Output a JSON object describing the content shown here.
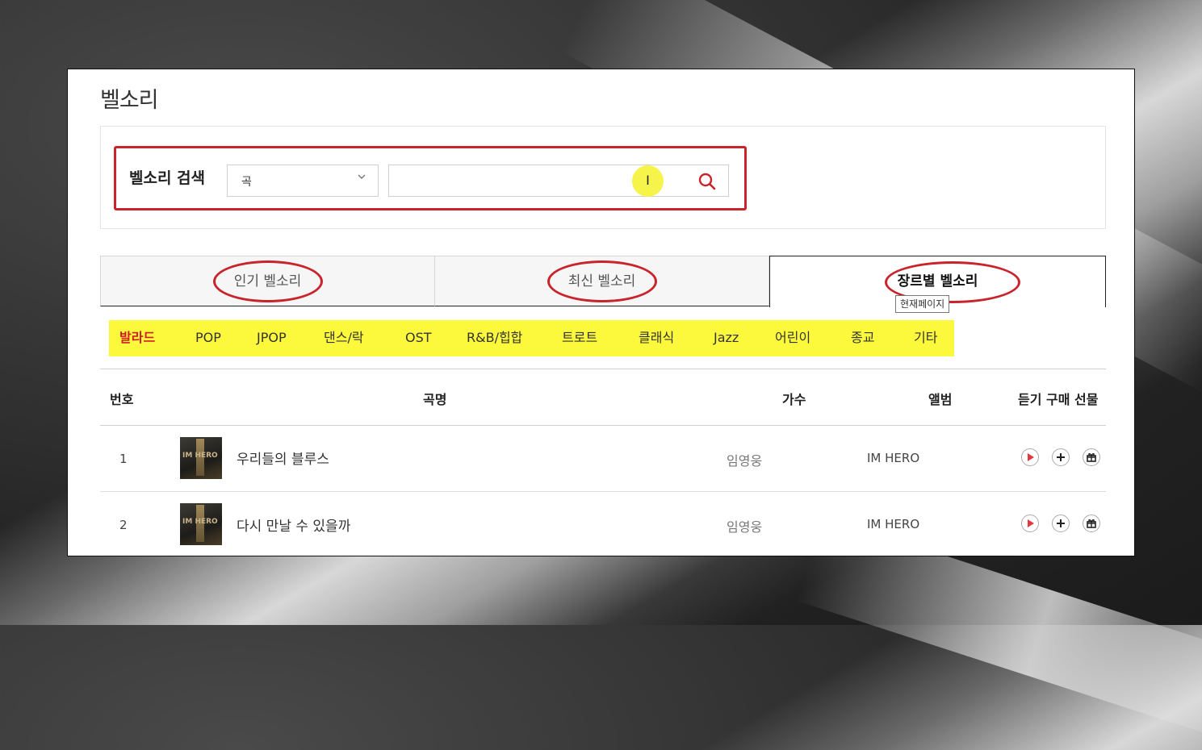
{
  "page": {
    "title": "벨소리"
  },
  "search": {
    "label": "벨소리 검색",
    "category_value": "곡",
    "query_value": "",
    "cursor_glyph": "I"
  },
  "tabs": [
    {
      "label": "인기 벨소리",
      "active": false
    },
    {
      "label": "최신 벨소리",
      "active": false
    },
    {
      "label": "장르별 벨소리",
      "active": true
    }
  ],
  "tab_tooltip": "현재페이지",
  "genres": [
    {
      "label": "발라드",
      "active": true
    },
    {
      "label": "POP",
      "active": false
    },
    {
      "label": "JPOP",
      "active": false
    },
    {
      "label": "댄스/락",
      "active": false
    },
    {
      "label": "OST",
      "active": false
    },
    {
      "label": "R&B/힙합",
      "active": false
    },
    {
      "label": "트로트",
      "active": false
    },
    {
      "label": "클래식",
      "active": false
    },
    {
      "label": "Jazz",
      "active": false
    },
    {
      "label": "어린이",
      "active": false
    },
    {
      "label": "종교",
      "active": false
    },
    {
      "label": "기타",
      "active": false
    }
  ],
  "table": {
    "headers": {
      "num": "번호",
      "title": "곡명",
      "artist": "가수",
      "album": "앨범",
      "actions": "듣기 구매 선물"
    },
    "rows": [
      {
        "num": "1",
        "title": "우리들의 블루스",
        "artist": "임영웅",
        "album": "IM HERO",
        "cover_text": "IM HERO"
      },
      {
        "num": "2",
        "title": "다시 만날 수 있을까",
        "artist": "임영웅",
        "album": "IM HERO",
        "cover_text": "IM HERO"
      }
    ]
  },
  "colors": {
    "accent_red": "#c9242c",
    "genre_bar": "#fcf93d",
    "active_genre": "#d11c24",
    "cursor_highlight": "#f6f34a"
  },
  "icons": {
    "search": "magnifier-icon",
    "dropdown": "chevron-down-icon",
    "play": "play-icon",
    "add": "plus-icon",
    "gift": "gift-icon"
  }
}
